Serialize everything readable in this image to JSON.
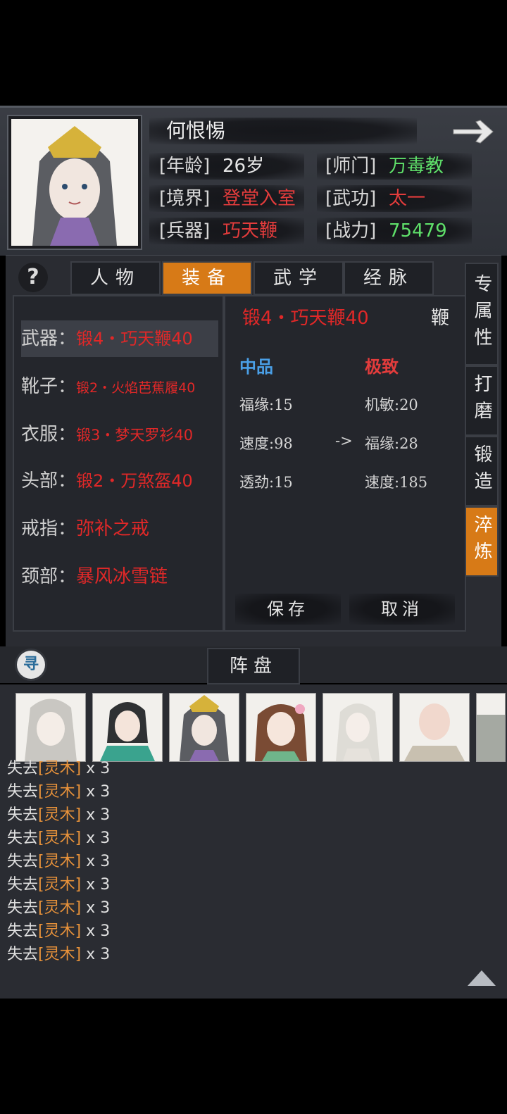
{
  "character": {
    "name": "何恨惕",
    "stats": [
      {
        "label": "[年龄]",
        "value": "26岁",
        "color": "#e6e6e6"
      },
      {
        "label": "[师门]",
        "value": "万毒教",
        "color": "#5fe06a"
      },
      {
        "label": "[境界]",
        "value": "登堂入室",
        "color": "#e33c3c"
      },
      {
        "label": "[武功]",
        "value": "太一",
        "color": "#e33c3c"
      },
      {
        "label": "[兵器]",
        "value": "巧天鞭",
        "color": "#e33c3c"
      },
      {
        "label": "[战力]",
        "value": "75479",
        "color": "#5fe06a"
      }
    ]
  },
  "tabs": [
    "人物",
    "装备",
    "武学",
    "经脉"
  ],
  "active_tab": "装备",
  "help_label": "?",
  "slots": [
    {
      "label": "武器：",
      "value": "锻4・巧天鞭40"
    },
    {
      "label": "靴子：",
      "value": "锻2・火焰芭蕉履40"
    },
    {
      "label": "衣服：",
      "value": "锻3・梦天罗衫40"
    },
    {
      "label": "头部：",
      "value": "锻2・万煞盔40"
    },
    {
      "label": "戒指：",
      "value": "弥补之戒"
    },
    {
      "label": "颈部：",
      "value": "暴风冰雪链"
    }
  ],
  "detail": {
    "item_name": "锻4・巧天鞭40",
    "item_type": "鞭",
    "grade_before": "中品",
    "grade_after": "极致",
    "arrow": "->",
    "before": [
      "福缘:15",
      "速度:98",
      "透劲:15"
    ],
    "after": [
      "机敏:20",
      "福缘:28",
      "速度:185"
    ],
    "save_label": "保存",
    "cancel_label": "取消"
  },
  "side_tabs": [
    "专属性",
    "打磨",
    "锻造",
    "淬炼"
  ],
  "active_side_tab": "淬炼",
  "formation_label": "阵盘",
  "search_icon_label": "寻",
  "log": {
    "prefix": "失去",
    "item": "[灵木]",
    "suffix": " x 3",
    "count": 9
  },
  "colors": {
    "accent": "#d77a17",
    "red": "#e33c3c",
    "green": "#5fe06a",
    "blue": "#4aa0e8",
    "log_item": "#e8923a"
  }
}
